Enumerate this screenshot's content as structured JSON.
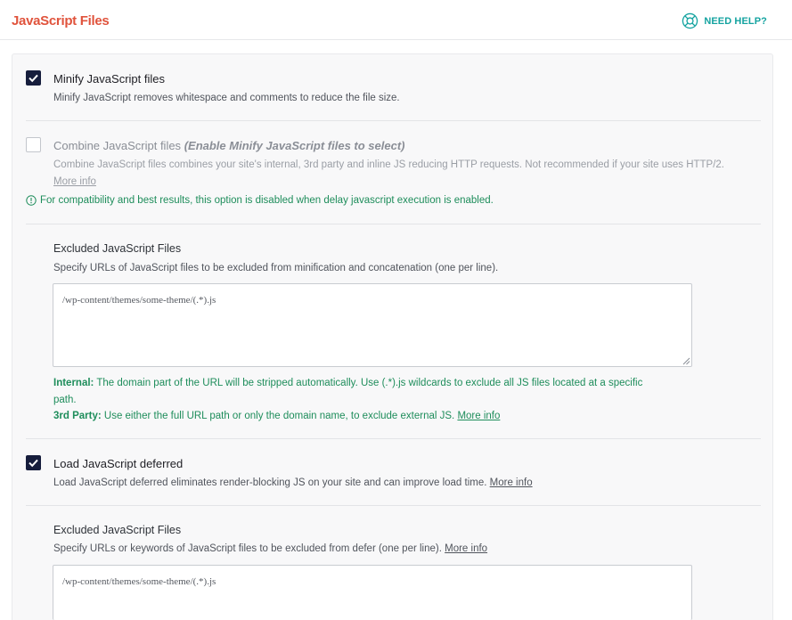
{
  "header": {
    "title": "JavaScript Files",
    "help_label": "NEED HELP?"
  },
  "minify": {
    "label": "Minify JavaScript files",
    "checked": true,
    "description": "Minify JavaScript removes whitespace and comments to reduce the file size."
  },
  "combine": {
    "label": "Combine JavaScript files",
    "note": "(Enable Minify JavaScript files to select)",
    "checked": false,
    "description": "Combine JavaScript files combines your site's internal, 3rd party and inline JS reducing HTTP requests. Not recommended if your site uses HTTP/2.",
    "more_info": "More info",
    "notice": "For compatibility and best results, this option is disabled when delay javascript execution is enabled."
  },
  "excluded_minify": {
    "title": "Excluded JavaScript Files",
    "description": "Specify URLs of JavaScript files to be excluded from minification and concatenation (one per line).",
    "value": "/wp-content/themes/some-theme/(.*).js",
    "help_internal_label": "Internal:",
    "help_internal_text": "The domain part of the URL will be stripped automatically. Use (.*).js wildcards to exclude all JS files located at a specific",
    "help_internal_text_2": "path.",
    "help_3rd_label": "3rd Party:",
    "help_3rd_text": "Use either the full URL path or only the domain name, to exclude external JS.",
    "more_info": "More info"
  },
  "deferred": {
    "label": "Load JavaScript deferred",
    "checked": true,
    "description": "Load JavaScript deferred eliminates render-blocking JS on your site and can improve load time.",
    "more_info": "More info"
  },
  "excluded_defer": {
    "title": "Excluded JavaScript Files",
    "description": "Specify URLs or keywords of JavaScript files to be excluded from defer (one per line).",
    "more_info": "More info",
    "value": "/wp-content/themes/some-theme/(.*).js"
  },
  "colors": {
    "title_accent": "#e0533c",
    "help_teal": "#14a3a0",
    "checkbox_dark": "#161d3c",
    "notice_green": "#1e8d5b"
  },
  "icons": {
    "help": "lifebuoy-icon",
    "checkbox": "checkmark-icon",
    "notice": "info-circle-icon",
    "textarea": "resize-grip-icon"
  }
}
